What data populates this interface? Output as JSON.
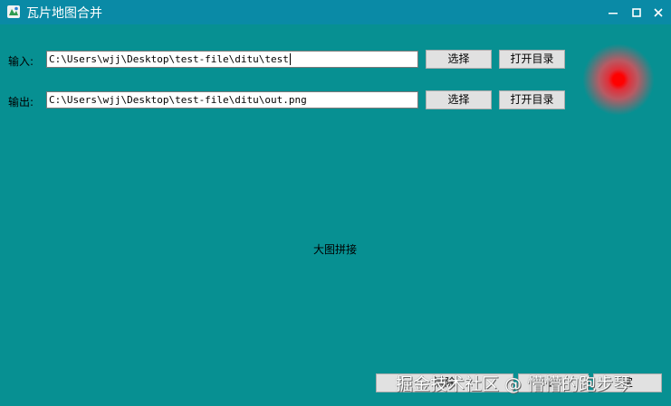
{
  "window": {
    "title": "瓦片地图合并",
    "icon": "app-map-icon",
    "controls": [
      "minimize-icon",
      "maximize-icon",
      "close-icon"
    ]
  },
  "input_row": {
    "label": "输入:",
    "value": "C:\\Users\\wjj\\Desktop\\test-file\\ditu\\test",
    "select_label": "选择",
    "open_dir_label": "打开目录"
  },
  "output_row": {
    "label": "输出:",
    "value": "C:\\Users\\wjj\\Desktop\\test-file\\ditu\\out.png",
    "select_label": "选择",
    "open_dir_label": "打开目录"
  },
  "status_indicator": {
    "color": "#ff0000",
    "icon": "status-dot-icon"
  },
  "center_label": "大图拼接",
  "bottom_buttons": [
    "清除",
    "止",
    "定"
  ],
  "watermark": "掘金技术社区 @ 懵懵的跑步琴",
  "colors": {
    "background": "#079092",
    "titlebar": "#0A8AA6",
    "button": "#e1e1e1"
  }
}
